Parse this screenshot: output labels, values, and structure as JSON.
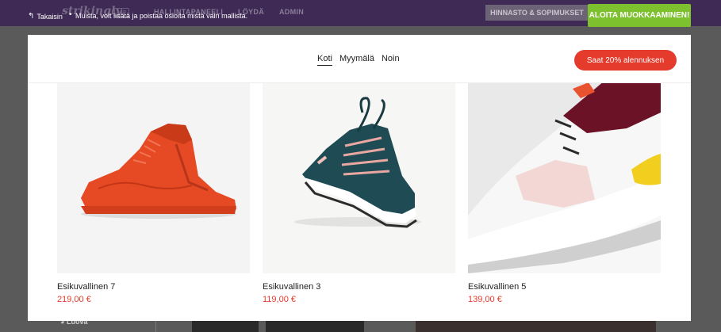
{
  "editor": {
    "logo": "strikingly",
    "vip_badge": "VIP",
    "nav": [
      "HALLINTAPANEELI",
      "LÖYDÄ",
      "ADMIN"
    ],
    "pricing_label": "HINNASTO & SOPIMUKSET",
    "start_button": "ALOITA MUOKKAAMINEN!",
    "back_label": "Takaisin",
    "notice": "Muista, voit lisätä ja poistaa osioita mistä vain mallista.",
    "sidebar_item": "Luova"
  },
  "site": {
    "nav": [
      {
        "label": "Koti",
        "active": true
      },
      {
        "label": "Myymälä",
        "active": false
      },
      {
        "label": "Noin",
        "active": false
      }
    ],
    "cta_label": "Saat 20% alennuksen"
  },
  "products": [
    {
      "name": "Esikuvallinen 7",
      "price": "219,00 €",
      "image": "red-high-top-sneaker"
    },
    {
      "name": "Esikuvallinen 3",
      "price": "119,00 €",
      "image": "teal-running-sneaker"
    },
    {
      "name": "Esikuvallinen 5",
      "price": "139,00 €",
      "image": "white-running-sneaker-closeup"
    }
  ],
  "colors": {
    "accent_red": "#e53b2c",
    "start_green": "#7dc12e",
    "topbar_purple": "#3f2a55"
  }
}
